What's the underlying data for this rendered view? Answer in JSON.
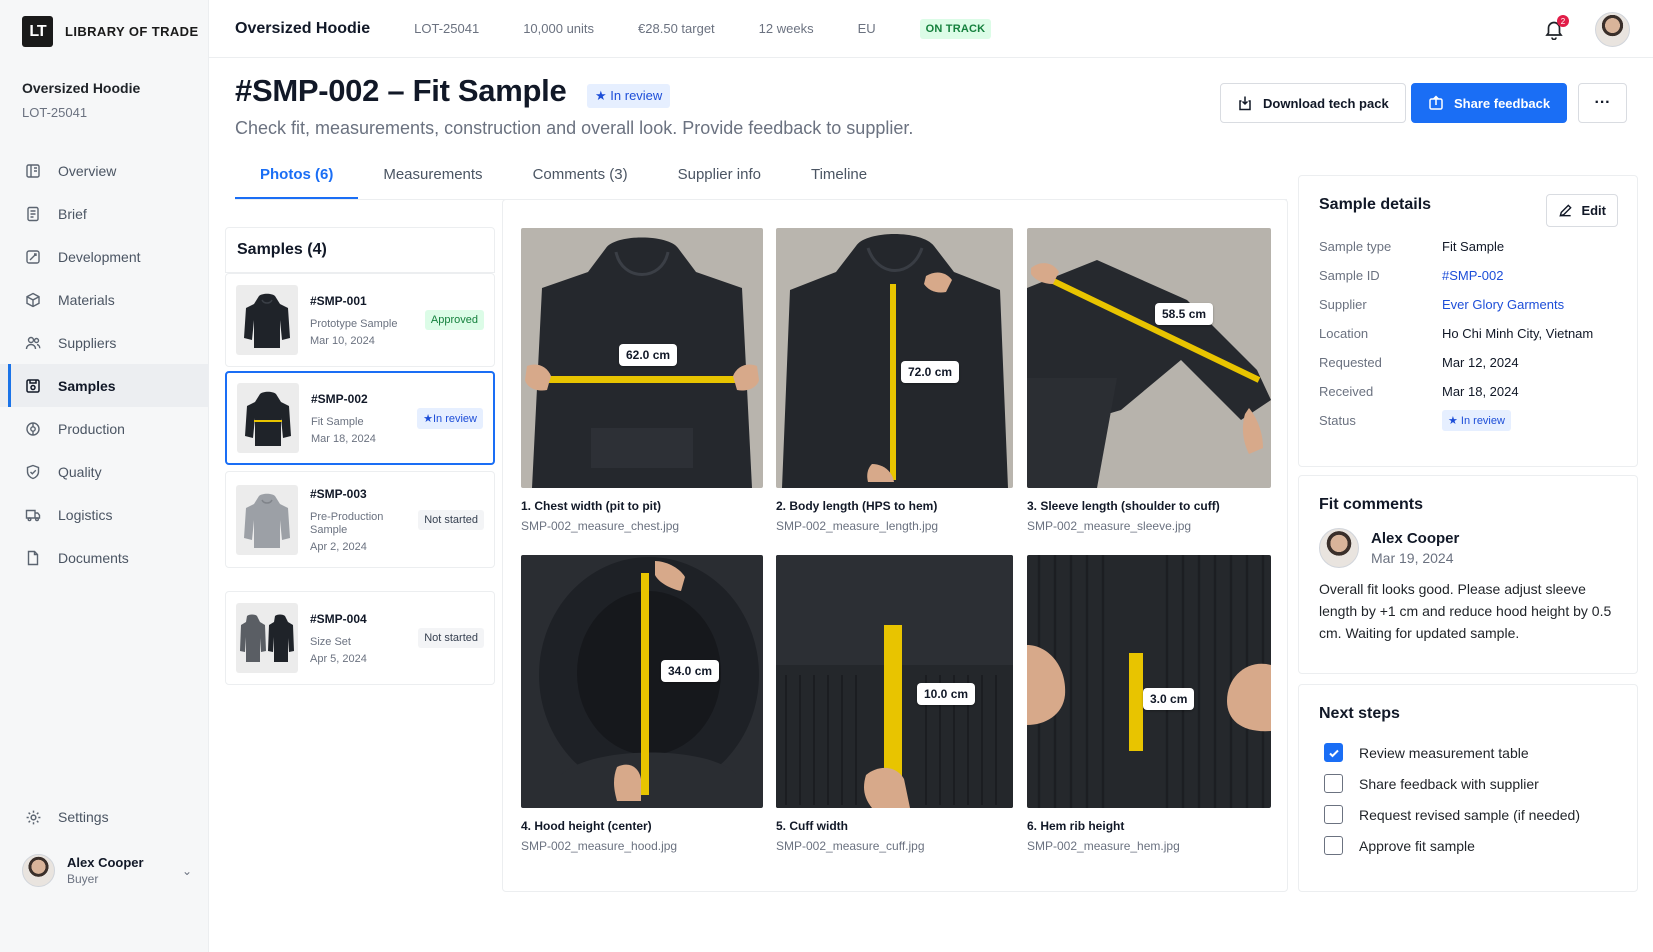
{
  "brand": {
    "logo": "LT",
    "name": "LIBRARY OF TRADE"
  },
  "project": {
    "name": "Oversized Hoodie",
    "lot": "LOT-25041"
  },
  "sidebar": {
    "items": [
      {
        "label": "Overview",
        "icon": "overview-icon"
      },
      {
        "label": "Brief",
        "icon": "brief-icon"
      },
      {
        "label": "Development",
        "icon": "development-icon"
      },
      {
        "label": "Materials",
        "icon": "materials-icon"
      },
      {
        "label": "Suppliers",
        "icon": "suppliers-icon"
      },
      {
        "label": "Samples",
        "icon": "samples-icon",
        "active": true
      },
      {
        "label": "Production",
        "icon": "production-icon"
      },
      {
        "label": "Quality",
        "icon": "quality-icon"
      },
      {
        "label": "Logistics",
        "icon": "logistics-icon"
      },
      {
        "label": "Documents",
        "icon": "documents-icon"
      }
    ],
    "settings_label": "Settings",
    "user": {
      "name": "Alex Cooper",
      "role": "Buyer"
    }
  },
  "topbar": {
    "title": "Oversized Hoodie",
    "lot": "LOT-25041",
    "units": "10,000 units",
    "target": "€28.50 target",
    "duration": "12 weeks",
    "region": "EU",
    "status": "ON TRACK",
    "notification_count": "2"
  },
  "page": {
    "title": "#SMP-002 – Fit Sample",
    "badge": "In review",
    "subtitle": "Check fit, measurements, construction and overall look. Provide feedback to supplier.",
    "download_label": "Download tech pack",
    "share_label": "Share feedback",
    "more_label": "···"
  },
  "tabs": [
    {
      "label": "Photos (6)",
      "active": true
    },
    {
      "label": "Measurements"
    },
    {
      "label": "Comments (3)"
    },
    {
      "label": "Supplier info"
    },
    {
      "label": "Timeline"
    }
  ],
  "samples": {
    "heading": "Samples (4)",
    "items": [
      {
        "id": "#SMP-001",
        "type": "Prototype Sample",
        "date": "Mar 10, 2024",
        "status": "Approved",
        "status_kind": "approved"
      },
      {
        "id": "#SMP-002",
        "type": "Fit Sample",
        "date": "Mar 18, 2024",
        "status": "In review",
        "status_kind": "review",
        "selected": true
      },
      {
        "id": "#SMP-003",
        "type": "Pre-Production Sample",
        "date": "Apr 2, 2024",
        "status": "Not started",
        "status_kind": "not"
      },
      {
        "id": "#SMP-004",
        "type": "Size Set",
        "date": "Apr 5, 2024",
        "status": "Not started",
        "status_kind": "not"
      }
    ]
  },
  "photos": [
    {
      "caption": "1. Chest width (pit to pit)",
      "file": "SMP-002_measure_chest.jpg",
      "measure": "62.0 cm"
    },
    {
      "caption": "2. Body length (HPS to hem)",
      "file": "SMP-002_measure_length.jpg",
      "measure": "72.0 cm"
    },
    {
      "caption": "3. Sleeve length (shoulder to cuff)",
      "file": "SMP-002_measure_sleeve.jpg",
      "measure": "58.5 cm"
    },
    {
      "caption": "4. Hood height (center)",
      "file": "SMP-002_measure_hood.jpg",
      "measure": "34.0 cm"
    },
    {
      "caption": "5. Cuff width",
      "file": "SMP-002_measure_cuff.jpg",
      "measure": "10.0 cm"
    },
    {
      "caption": "6. Hem rib height",
      "file": "SMP-002_measure_hem.jpg",
      "measure": "3.0 cm"
    }
  ],
  "details": {
    "title": "Sample details",
    "edit_label": "Edit",
    "rows": [
      {
        "label": "Sample type",
        "value": "Fit Sample"
      },
      {
        "label": "Sample ID",
        "value": "#SMP-002",
        "link": true
      },
      {
        "label": "Supplier",
        "value": "Ever Glory Garments",
        "link": true
      },
      {
        "label": "Location",
        "value": "Ho Chi Minh City, Vietnam"
      },
      {
        "label": "Requested",
        "value": "Mar 12, 2024"
      },
      {
        "label": "Received",
        "value": "Mar 18, 2024"
      },
      {
        "label": "Status",
        "value": "In review"
      }
    ]
  },
  "fit_comments": {
    "title": "Fit comments",
    "author": "Alex Cooper",
    "date": "Mar 19, 2024",
    "text": "Overall fit looks good. Please adjust sleeve length by +1 cm and reduce hood height by 0.5 cm. Waiting for updated sample."
  },
  "next_steps": {
    "title": "Next steps",
    "items": [
      {
        "label": "Review measurement table",
        "checked": true
      },
      {
        "label": "Share feedback with supplier",
        "checked": false
      },
      {
        "label": "Request revised sample (if needed)",
        "checked": false
      },
      {
        "label": "Approve fit sample",
        "checked": false
      }
    ]
  },
  "colors": {
    "accent": "#1a6ef5",
    "success": "#15803d",
    "sidebar_bg": "#f6f7f8"
  }
}
